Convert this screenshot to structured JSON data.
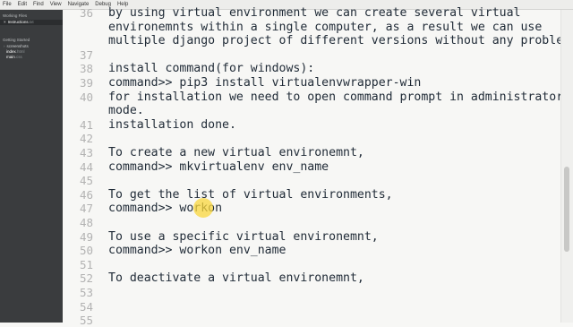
{
  "menu": [
    "File",
    "Edit",
    "Find",
    "View",
    "Navigate",
    "Debug",
    "Help"
  ],
  "sidebar": {
    "working_files_label": "Working Files",
    "open_file": {
      "name": "Instructions",
      "ext": ".txt"
    },
    "project_label": "Getting Started",
    "tree": [
      {
        "name": "screenshots",
        "ext": "",
        "type": "folder"
      },
      {
        "name": "index",
        "ext": ".html",
        "type": "file"
      },
      {
        "name": "main",
        "ext": ".css",
        "type": "file"
      }
    ]
  },
  "editor": {
    "lines": [
      {
        "num": "36",
        "text": "by using virtual environment we can create several virtual"
      },
      {
        "num": "",
        "text": "environemnts within a single computer, as a result we can use"
      },
      {
        "num": "",
        "text": "multiple django project of different versions without any problem."
      },
      {
        "num": "37",
        "text": ""
      },
      {
        "num": "38",
        "text": "install command(for windows):"
      },
      {
        "num": "39",
        "text": "command>> pip3 install virtualenvwrapper-win"
      },
      {
        "num": "40",
        "text": "for installation we need to open command prompt in administrator"
      },
      {
        "num": "",
        "text": "mode."
      },
      {
        "num": "41",
        "text": "installation done."
      },
      {
        "num": "42",
        "text": ""
      },
      {
        "num": "43",
        "text": "To create a new virtual environemnt,"
      },
      {
        "num": "44",
        "text": "command>> mkvirtualenv env_name"
      },
      {
        "num": "45",
        "text": ""
      },
      {
        "num": "46",
        "text": "To get the list of virtual environments,"
      },
      {
        "num": "47",
        "text": "command>> workon"
      },
      {
        "num": "48",
        "text": ""
      },
      {
        "num": "49",
        "text": "To use a specific virtual environemnt,"
      },
      {
        "num": "50",
        "text": "command>> workon env_name"
      },
      {
        "num": "51",
        "text": ""
      },
      {
        "num": "52",
        "text": "To deactivate a virtual environemnt,"
      },
      {
        "num": "53",
        "text": ""
      },
      {
        "num": "54",
        "text": ""
      },
      {
        "num": "55",
        "text": ""
      }
    ]
  },
  "colors": {
    "sidebar_bg": "#3a3c3e",
    "editor_bg": "#f7f7f5",
    "text": "#1f2a36",
    "line_number": "#b2b2b2",
    "cursor_highlight": "#fad73c"
  }
}
